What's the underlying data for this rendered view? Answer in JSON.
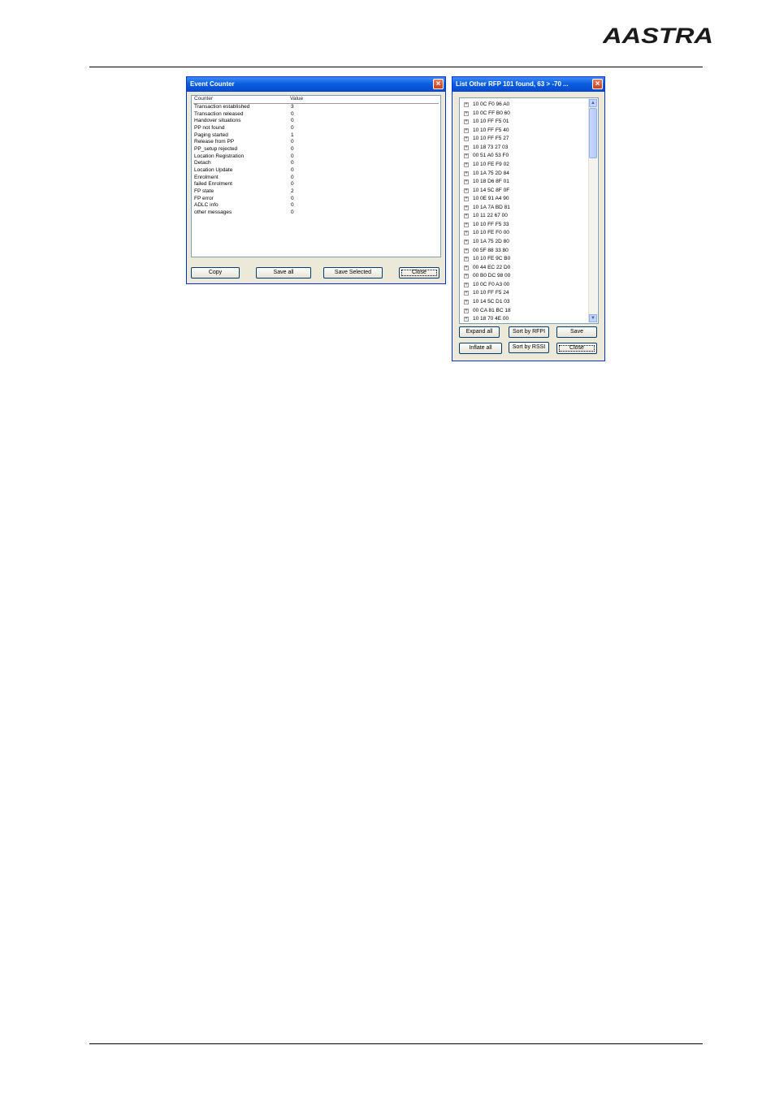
{
  "brand": {
    "logo_text": "AASTRA"
  },
  "event_counter": {
    "title": "Event Counter",
    "columns": {
      "counter": "Counter",
      "value": "Value"
    },
    "rows": [
      {
        "name": "Transaction established",
        "value": "3"
      },
      {
        "name": "Transaction released",
        "value": "0"
      },
      {
        "name": "Handover situations",
        "value": "0"
      },
      {
        "name": "PP not found",
        "value": "0"
      },
      {
        "name": "Paging started",
        "value": "1"
      },
      {
        "name": "Release from PP",
        "value": "0"
      },
      {
        "name": "PP_setup rejected",
        "value": "0"
      },
      {
        "name": "Location Registration",
        "value": "0"
      },
      {
        "name": "Detach",
        "value": "0"
      },
      {
        "name": "Location Update",
        "value": "0"
      },
      {
        "name": "Enrolment",
        "value": "0"
      },
      {
        "name": "failed Enrolment",
        "value": "0"
      },
      {
        "name": "FP state",
        "value": "2"
      },
      {
        "name": "FP error",
        "value": "0"
      },
      {
        "name": "ADLC info",
        "value": "0"
      },
      {
        "name": "other messages",
        "value": "0"
      }
    ],
    "buttons": {
      "copy": "Copy",
      "save_all": "Save all",
      "save_selected": "Save Selected",
      "close": "Close"
    }
  },
  "rfp_list": {
    "title": "List Other RFP  101 found, 63 > -70 ...",
    "items": [
      "10 0C F0 96 A0",
      "10 0C FF B0 60",
      "10 10 FF F5 01",
      "10 10 FF F5 40",
      "10 10 FF F5 27",
      "10 18 73 27 03",
      "00 51 A0 53 F0",
      "10 10 FE F9 02",
      "10 1A 75 2D 84",
      "10 18 D6 8F 01",
      "10 14 5C 8F 0F",
      "10 0E 91 A4 90",
      "10 1A 7A BD 81",
      "10 11 22 67 00",
      "10 10 FF F5 33",
      "10 10 FE F0 00",
      "10 1A 75 2D 80",
      "00 5F 88 33 80",
      "10 10 FE 9C B0",
      "00 44 EC 22 D0",
      "00 B0 DC 98 00",
      "10 0C F0 A3 00",
      "10 10 FF F5 24",
      "10 14 5C D1 03",
      "00 CA 81 BC 18",
      "10 18 70 4E 00"
    ],
    "buttons": {
      "expand_all": "Expand all",
      "sort_by_rfpi": "Sort by RFPI",
      "save": "Save",
      "inflate_all": "Inflate all",
      "sort_by_rssi": "Sort by RSSI",
      "close": "Close"
    }
  }
}
